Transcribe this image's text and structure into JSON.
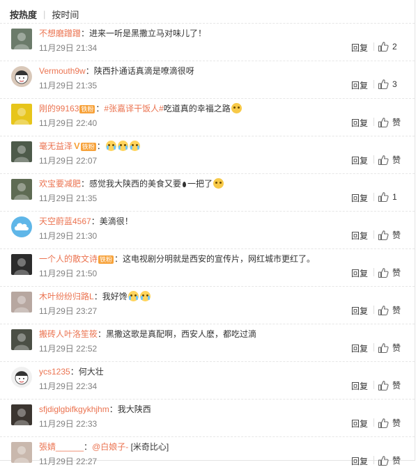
{
  "tabs": [
    "按热度",
    "按时间"
  ],
  "comments": [
    {
      "user": "不想磨蹭蹭",
      "badge": "",
      "vip": "",
      "text": "进来一听是黑撒立马对味儿了！",
      "time": "11月29日 21:34",
      "reply": "回复",
      "likes": "2",
      "avatar_color": "#6b7b6a",
      "avatar_icon": "avatar-photo"
    },
    {
      "user": "Vermouth9w",
      "badge": "",
      "vip": "",
      "text": "陕西扑通话真滴是嘹滴很呀",
      "time": "11月29日 21:35",
      "reply": "回复",
      "likes": "3",
      "avatar_color": "#d9c8b9",
      "avatar_icon": "avatar-cartoon"
    },
    {
      "user": "刚的99163",
      "badge": "铁粉",
      "vip": "",
      "topic": "#张嘉译干饭人#",
      "text": "吃道真的幸福之路",
      "emoji_after": "dog",
      "time": "11月29日 22:40",
      "reply": "回复",
      "likes": "赞",
      "avatar_color": "#e7c51b",
      "avatar_icon": "avatar-photo"
    },
    {
      "user": "毫无益泽",
      "badge": "铁粉",
      "vip": "V",
      "text": "",
      "emojis": 3,
      "time": "11月29日 22:07",
      "reply": "回复",
      "likes": "赞",
      "avatar_color": "#4d5a4a",
      "avatar_icon": "avatar-photo"
    },
    {
      "user": "欢宝要减肥",
      "badge": "",
      "vip": "",
      "text": "感觉我大陕西的美食又要",
      "text2": "一把了",
      "time": "11月29日 21:35",
      "reply": "回复",
      "likes": "1",
      "avatar_color": "#5e6b53",
      "avatar_icon": "avatar-photo"
    },
    {
      "user": "天空蔚蓝4567",
      "badge": "",
      "vip": "",
      "text": "美滴很！",
      "time": "11月29日 21:30",
      "reply": "回复",
      "likes": "赞",
      "avatar_color": "#5fb6e8",
      "avatar_icon": "avatar-cloud"
    },
    {
      "user": "一个人的散文诗",
      "badge": "铁粉",
      "vip": "",
      "text": "这电视剧分明就是西安的宣传片，网红城市更红了。",
      "time": "11月29日 21:50",
      "reply": "回复",
      "likes": "赞",
      "avatar_color": "#2c2c2c",
      "avatar_icon": "avatar-photo"
    },
    {
      "user": "木叶纷纷归路L",
      "badge": "",
      "vip": "",
      "text": "我好馋",
      "emojis": 2,
      "time": "11月29日 23:27",
      "reply": "回复",
      "likes": "赞",
      "avatar_color": "#b7a7a0",
      "avatar_icon": "avatar-photo"
    },
    {
      "user": "搬砖人叶洛笙筱",
      "badge": "",
      "vip": "",
      "text": "黑撒这歌是真配啊，西安人麽，都吃过滴",
      "time": "11月29日 22:52",
      "reply": "回复",
      "likes": "赞",
      "avatar_color": "#4b4f45",
      "avatar_icon": "avatar-photo"
    },
    {
      "user": "ycs1235",
      "badge": "",
      "vip": "",
      "text": "何大壮",
      "time": "11月29日 22:34",
      "reply": "回复",
      "likes": "赞",
      "avatar_color": "#f0f0f0",
      "avatar_icon": "avatar-cartoon"
    },
    {
      "user": "sfjdiglgbifkgykhjhm",
      "badge": "",
      "vip": "",
      "text": "我大陕西",
      "time": "11月29日 22:33",
      "reply": "回复",
      "likes": "赞",
      "avatar_color": "#3b3530",
      "avatar_icon": "avatar-photo"
    },
    {
      "user": "張婧______",
      "badge": "",
      "vip": "",
      "text": "@白娘子-",
      "text2": "[米奇比心]",
      "time": "11月29日 22:27",
      "reply": "回复",
      "likes": "赞",
      "avatar_color": "#c9b8ad",
      "avatar_icon": "avatar-photo"
    }
  ]
}
